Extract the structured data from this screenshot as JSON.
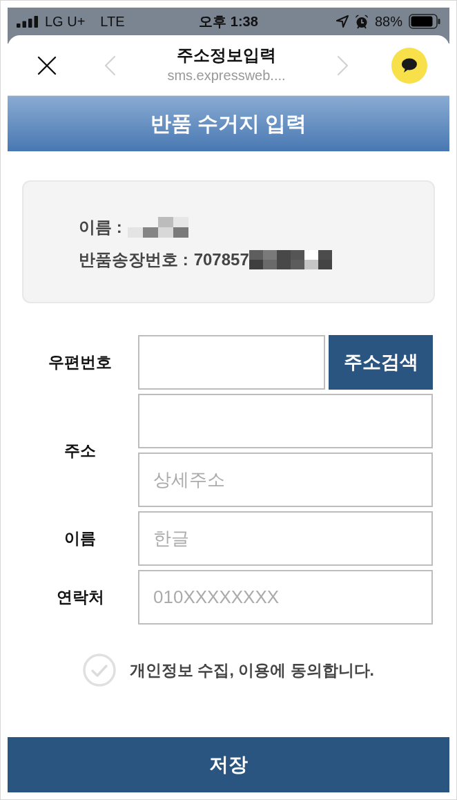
{
  "status_bar": {
    "carrier": "LG U+",
    "network": "LTE",
    "time": "오후 1:38",
    "battery": "88%"
  },
  "browser_bar": {
    "title": "주소정보입력",
    "url": "sms.expressweb....",
    "back_disabled": true,
    "forward_disabled": true
  },
  "header": {
    "title": "반품 수거지 입력"
  },
  "info_card": {
    "lines": [
      {
        "label": "이름 :",
        "redacted": true
      },
      {
        "label": "반품송장번호 :",
        "value": "707857",
        "redacted": true
      }
    ]
  },
  "form": {
    "rows": [
      {
        "label": "우편번호",
        "fields": [
          {
            "kind": "text"
          }
        ],
        "button": "주소검색"
      },
      {
        "label": "주소",
        "fields": [
          {
            "kind": "text"
          },
          {
            "kind": "text",
            "placeholder": "상세주소"
          }
        ]
      },
      {
        "label": "이름",
        "fields": [
          {
            "kind": "text",
            "placeholder": "한글"
          }
        ]
      },
      {
        "label": "연락처",
        "fields": [
          {
            "kind": "text",
            "placeholder": "010XXXXXXXX"
          }
        ]
      }
    ]
  },
  "consent": {
    "label": "개인정보 수집, 이용에 동의합니다.",
    "checked": false
  },
  "save_button": {
    "label": "저장"
  }
}
